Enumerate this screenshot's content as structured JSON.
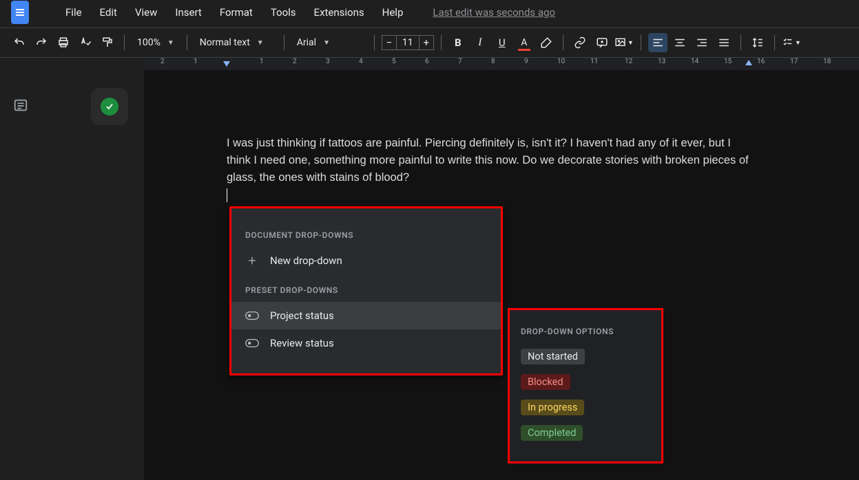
{
  "menubar": {
    "items": [
      "File",
      "Edit",
      "View",
      "Insert",
      "Format",
      "Tools",
      "Extensions",
      "Help"
    ],
    "last_edit": "Last edit was seconds ago"
  },
  "toolbar": {
    "zoom": "100%",
    "style": "Normal text",
    "font": "Arial",
    "font_size": "11"
  },
  "ruler": {
    "numbers": [
      "2",
      "1",
      "1",
      "2",
      "3",
      "4",
      "5",
      "6",
      "7",
      "8",
      "9",
      "10",
      "11",
      "12",
      "13",
      "14",
      "15",
      "16",
      "17",
      "18"
    ]
  },
  "body_text": "I was just thinking if tattoos are painful. Piercing definitely is, isn't it? I haven't had any of it ever, but I think I need one, something more painful to write this now. Do we decorate stories with broken pieces of glass, the ones with stains of blood?",
  "dropdown_menu": {
    "section1_label": "DOCUMENT DROP-DOWNS",
    "new_dropdown": "New drop-down",
    "section2_label": "PRESET DROP-DOWNS",
    "presets": [
      "Project status",
      "Review status"
    ]
  },
  "options_panel": {
    "label": "DROP-DOWN OPTIONS",
    "options": [
      {
        "text": "Not started",
        "class": "chip-notstarted"
      },
      {
        "text": "Blocked",
        "class": "chip-blocked"
      },
      {
        "text": "In progress",
        "class": "chip-inprogress"
      },
      {
        "text": "Completed",
        "class": "chip-completed"
      }
    ]
  }
}
